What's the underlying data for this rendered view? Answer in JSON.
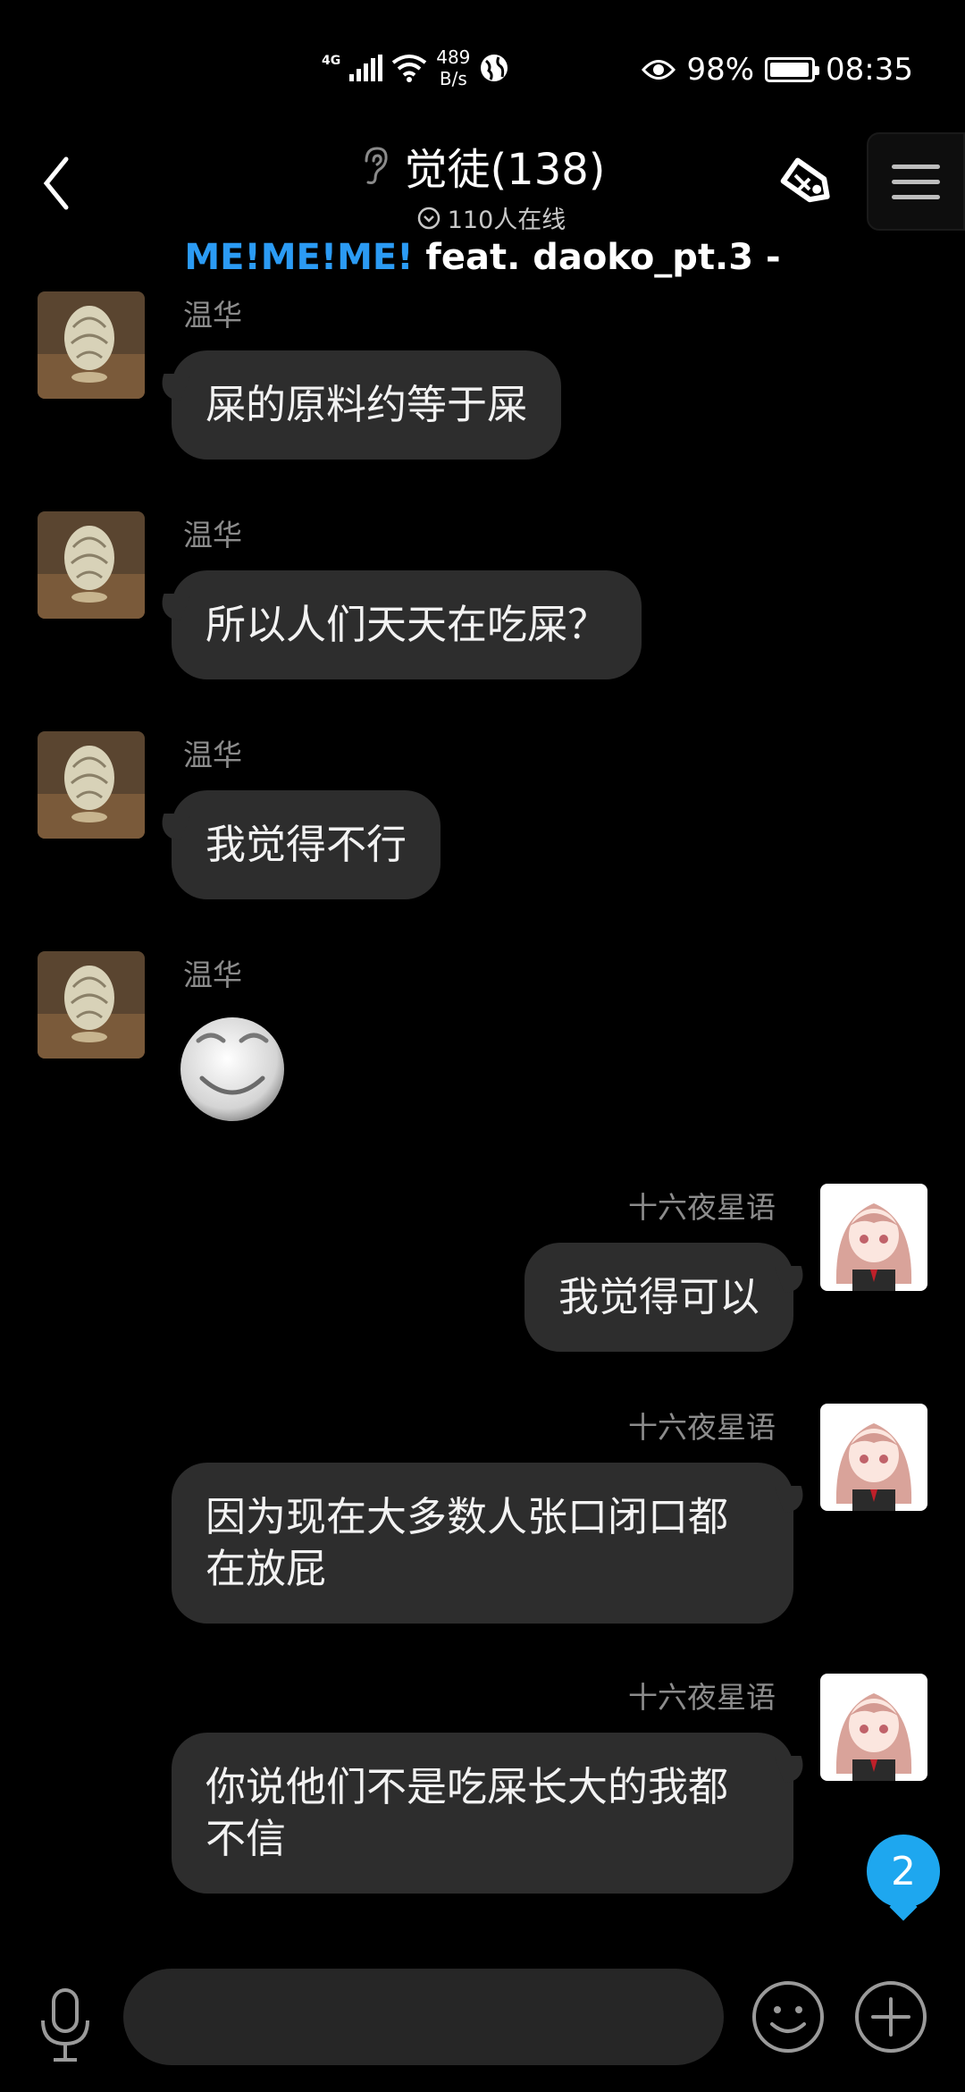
{
  "status_bar": {
    "network": "4G",
    "speed_value": "489",
    "speed_unit": "B/s",
    "battery": "98%",
    "time": "08:35",
    "icons": [
      "signal-icon",
      "wifi-icon",
      "vpn-globe-icon",
      "eye-icon",
      "battery-icon"
    ]
  },
  "header": {
    "title": "觉徒(138)",
    "online": "110人在线",
    "music_highlight": "ME!ME!ME!",
    "music_rest": " feat. daoko_pt.3 -"
  },
  "messages": [
    {
      "side": "left",
      "sender": "温华",
      "text": "屎的原料约等于屎"
    },
    {
      "side": "left",
      "sender": "温华",
      "text": "所以人们天天在吃屎？"
    },
    {
      "side": "left",
      "sender": "温华",
      "text": "我觉得不行"
    },
    {
      "side": "left",
      "sender": "温华",
      "text": "",
      "sticker": "smile-face-icon"
    },
    {
      "side": "right",
      "sender": "十六夜星语",
      "text": "我觉得可以"
    },
    {
      "side": "right",
      "sender": "十六夜星语",
      "text": "因为现在大多数人张口闭口都在放屁"
    },
    {
      "side": "right",
      "sender": "十六夜星语",
      "text": "你说他们不是吃屎长大的我都不信"
    }
  ],
  "unread_count": "2",
  "colors": {
    "background": "#000000",
    "bubble": "#2d2d2d",
    "accent_blue": "#2b9bf4",
    "badge": "#1ea7ef"
  }
}
